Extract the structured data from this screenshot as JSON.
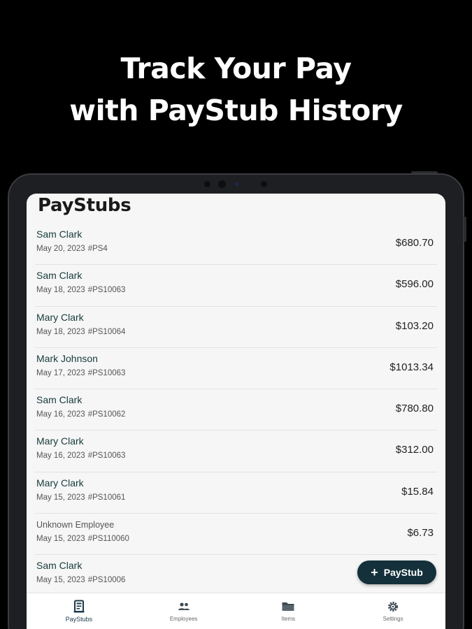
{
  "headline": {
    "line1": "Track Your Pay",
    "line2": "with PayStub History"
  },
  "screen": {
    "title": "PayStubs",
    "paystubs": [
      {
        "name": "Sam Clark",
        "date": "May 20, 2023",
        "id": "#PS4",
        "amount": "$680.70"
      },
      {
        "name": "Sam Clark",
        "date": "May 18, 2023",
        "id": "#PS10063",
        "amount": "$596.00"
      },
      {
        "name": "Mary Clark",
        "date": "May 18, 2023",
        "id": "#PS10064",
        "amount": "$103.20"
      },
      {
        "name": "Mark Johnson",
        "date": "May 17, 2023",
        "id": "#PS10063",
        "amount": "$1013.34"
      },
      {
        "name": "Sam Clark",
        "date": "May 16, 2023",
        "id": "#PS10062",
        "amount": "$780.80"
      },
      {
        "name": "Mary Clark",
        "date": "May 16, 2023",
        "id": "#PS10063",
        "amount": "$312.00"
      },
      {
        "name": "Mary Clark",
        "date": "May 15, 2023",
        "id": "#PS10061",
        "amount": "$15.84"
      },
      {
        "name": "Unknown Employee",
        "date": "May 15, 2023",
        "id": "#PS110060",
        "amount": "$6.73"
      },
      {
        "name": "Sam Clark",
        "date": "May 15, 2023",
        "id": "#PS10006",
        "amount": ""
      }
    ],
    "fab_label": "PayStub",
    "nav": [
      {
        "label": "PayStubs",
        "icon": "paystub-icon"
      },
      {
        "label": "Employees",
        "icon": "people-icon"
      },
      {
        "label": "Items",
        "icon": "folder-icon"
      },
      {
        "label": "Settings",
        "icon": "gear-icon"
      }
    ]
  },
  "colors": {
    "fab": "#14303a",
    "name_text": "#163a3a",
    "background": "#000000"
  }
}
